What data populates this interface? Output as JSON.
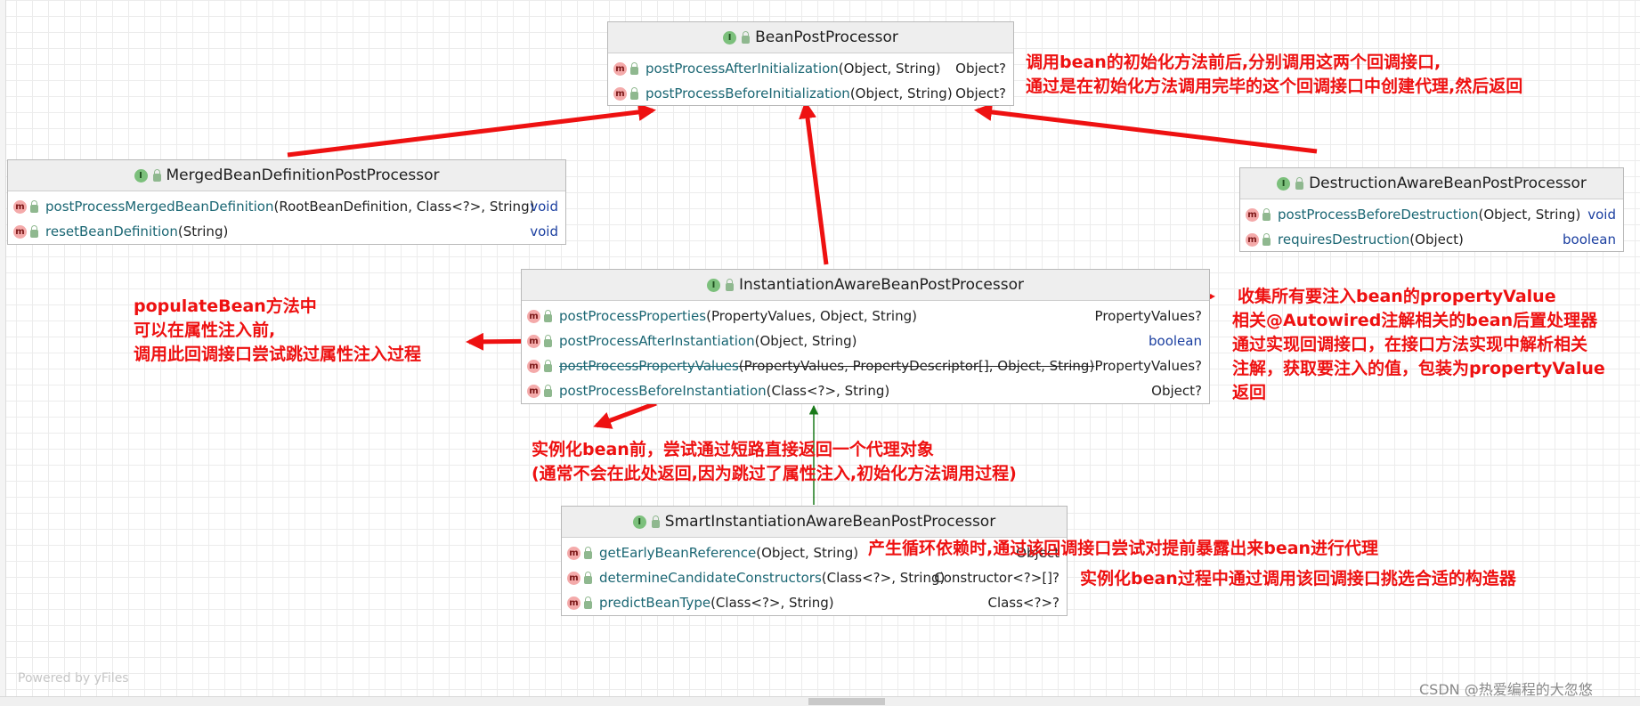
{
  "classes": {
    "bean_post_processor": {
      "name": "BeanPostProcessor",
      "methods": [
        {
          "name": "postProcessAfterInitialization",
          "params": "(Object, String)",
          "returns": "Object?"
        },
        {
          "name": "postProcessBeforeInitialization",
          "params": "(Object, String)",
          "returns": "Object?"
        }
      ]
    },
    "merged": {
      "name": "MergedBeanDefinitionPostProcessor",
      "methods": [
        {
          "name": "postProcessMergedBeanDefinition",
          "params": "(RootBeanDefinition, Class<?>, String)",
          "returns": "void"
        },
        {
          "name": "resetBeanDefinition",
          "params": "(String)",
          "returns": "void"
        }
      ]
    },
    "destruction": {
      "name": "DestructionAwareBeanPostProcessor",
      "methods": [
        {
          "name": "postProcessBeforeDestruction",
          "params": "(Object, String)",
          "returns": "void"
        },
        {
          "name": "requiresDestruction",
          "params": "(Object)",
          "returns": "boolean"
        }
      ]
    },
    "instantiation": {
      "name": "InstantiationAwareBeanPostProcessor",
      "methods": [
        {
          "name": "postProcessProperties",
          "params": "(PropertyValues, Object, String)",
          "returns": "PropertyValues?"
        },
        {
          "name": "postProcessAfterInstantiation",
          "params": "(Object, String)",
          "returns": "boolean"
        },
        {
          "name": "postProcessPropertyValues",
          "params": "(PropertyValues, PropertyDescriptor[], Object, String)",
          "returns": "PropertyValues?"
        },
        {
          "name": "postProcessBeforeInstantiation",
          "params": "(Class<?>, String)",
          "returns": "Object?"
        }
      ]
    },
    "smart": {
      "name": "SmartInstantiationAwareBeanPostProcessor",
      "methods": [
        {
          "name": "getEarlyBeanReference",
          "params": "(Object, String)",
          "returns": "Object"
        },
        {
          "name": "determineCandidateConstructors",
          "params": "(Class<?>, String)",
          "returns": "Constructor<?>[]?"
        },
        {
          "name": "predictBeanType",
          "params": "(Class<?>, String)",
          "returns": "Class<?>?"
        }
      ]
    }
  },
  "notes": {
    "bpp": [
      "调用bean的初始化方法前后,分别调用这两个回调接口,",
      "通过是在初始化方法调用完毕的这个回调接口中创建代理,然后返回"
    ],
    "populate": [
      "populateBean方法中",
      "可以在属性注入前,",
      "调用此回调接口尝试跳过属性注入过程"
    ],
    "collect": [
      "收集所有要注入bean的propertyValue",
      "相关@Autowired注解相关的bean后置处理器",
      "通过实现回调接口，在接口方法实现中解析相关",
      "注解，获取要注入的值，包装为propertyValue",
      "返回"
    ],
    "before_inst": [
      "实例化bean前，尝试通过短路直接返回一个代理对象",
      "(通常不会在此处返回,因为跳过了属性注入,初始化方法调用过程)"
    ],
    "early": "产生循环依赖时,通过该回调接口尝试对提前暴露出来bean进行代理",
    "constructors": "实例化bean过程中通过调用该回调接口挑选合适的构造器"
  },
  "watermark": "Powered by yFiles",
  "credit": "CSDN @热爱编程的大忽悠",
  "colors": {
    "annotation": "#ee1111",
    "inheritance": "#1a7a1a"
  },
  "icons": {
    "interface": "interface-icon",
    "method": "method-icon",
    "public": "public-icon"
  }
}
